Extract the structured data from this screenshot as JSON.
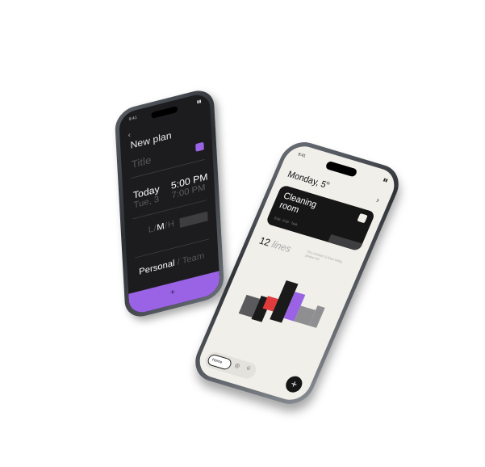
{
  "left_phone": {
    "status_time": "9:41",
    "back_glyph": "‹",
    "title": "New plan",
    "title_placeholder": "Title",
    "date_primary": "Today",
    "date_secondary": "Tue, 3",
    "time_primary": "5:00 PM",
    "time_secondary": "7:00 PM",
    "priority": {
      "low": "L",
      "sep1": "/",
      "mid": "M",
      "sep2": "/",
      "high": "H"
    },
    "category": {
      "selected": "Personal",
      "sep": " / ",
      "other": "Team"
    },
    "footer_icon": "+",
    "accent_color": "#9a63e6"
  },
  "right_phone": {
    "status_time": "9:41",
    "header_day": "Monday, 5",
    "header_sup": "th",
    "chevron_glyph": "›",
    "card_title": "Cleaning room",
    "card_time": "8:00 - 9:00 · Task",
    "lines_count": "12",
    "lines_label": "lines",
    "note": "You created 12 lines today, please not",
    "nav_home": "Home",
    "fab_label": "+",
    "accent_color": "#9a63e6",
    "highlight_color": "#e23b3b"
  }
}
